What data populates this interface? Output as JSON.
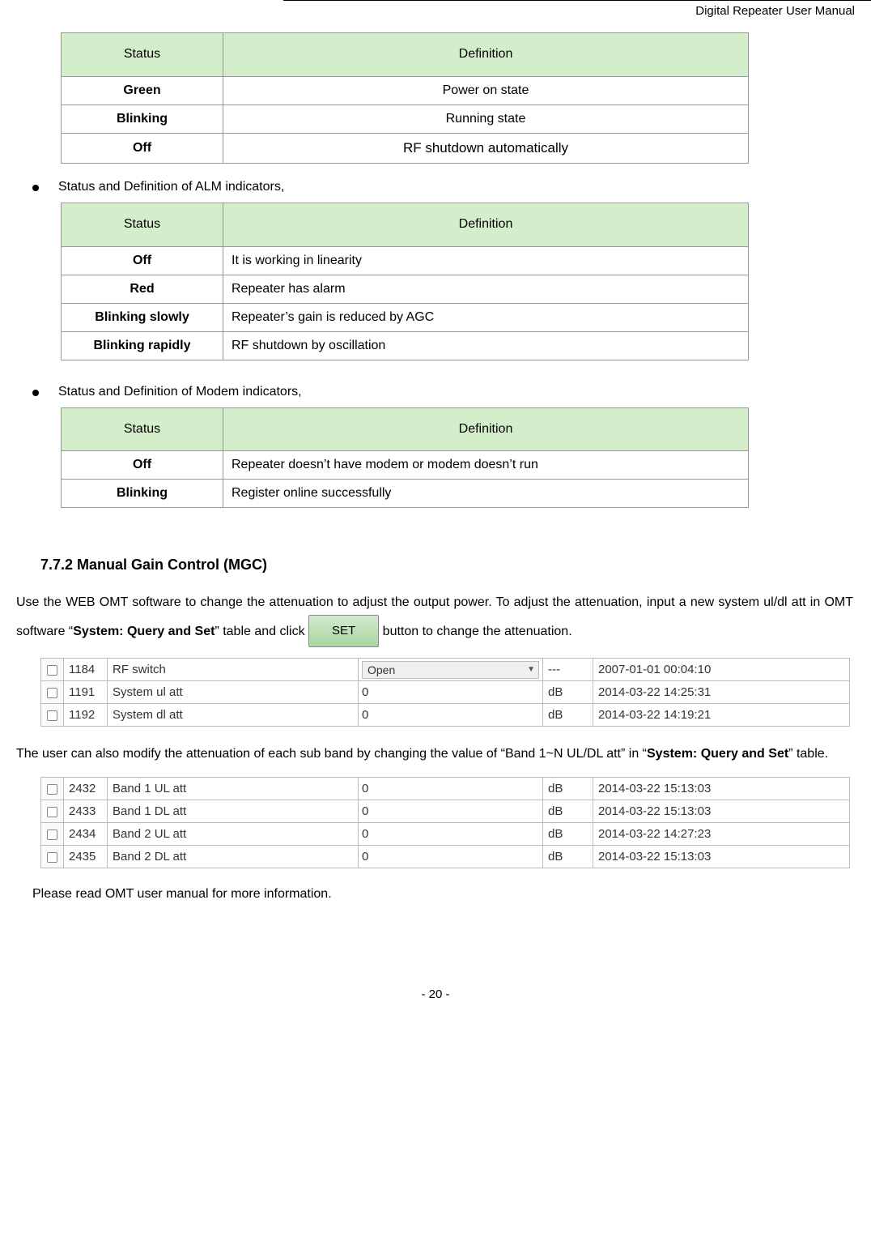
{
  "header": {
    "title": "Digital Repeater User Manual"
  },
  "table1": {
    "cols": [
      "Status",
      "Definition"
    ],
    "rows": [
      {
        "status": "Green",
        "def": "Power on state"
      },
      {
        "status": "Blinking",
        "def": "Running state"
      },
      {
        "status": "Off",
        "def": "RF shutdown automatically"
      }
    ]
  },
  "bullet1": "Status and Definition of ALM indicators,",
  "table2": {
    "cols": [
      "Status",
      "Definition"
    ],
    "rows": [
      {
        "status": "Off",
        "def": "It is working in linearity"
      },
      {
        "status": "Red",
        "def": "Repeater has alarm"
      },
      {
        "status": "Blinking slowly",
        "def": "Repeater’s gain is reduced by AGC"
      },
      {
        "status": "Blinking rapidly",
        "def": "RF shutdown by oscillation"
      }
    ]
  },
  "bullet2": "Status and Definition of Modem indicators,",
  "table3": {
    "cols": [
      "Status",
      "Definition"
    ],
    "rows": [
      {
        "status": "Off",
        "def": "Repeater doesn’t have modem or modem doesn’t run"
      },
      {
        "status": "Blinking",
        "def": "Register online successfully"
      }
    ]
  },
  "section_heading": "7.7.2 Manual Gain Control (MGC)",
  "para1_a": "Use the WEB OMT software to change the attenuation to adjust the output power. To adjust the attenuation, input a new system ul/dl att in OMT software “",
  "para1_bold": "System: Query and Set",
  "para1_b": "” table and click ",
  "set_label": "SET",
  "para1_c": " button to change the attenuation.",
  "omt1": [
    {
      "id": "1184",
      "name": "RF switch",
      "val_type": "select",
      "val": "Open",
      "unit": "---",
      "date": "2007-01-01 00:04:10"
    },
    {
      "id": "1191",
      "name": "System ul att",
      "val_type": "text",
      "val": "0",
      "unit": "dB",
      "date": "2014-03-22 14:25:31"
    },
    {
      "id": "1192",
      "name": "System dl att",
      "val_type": "text",
      "val": "0",
      "unit": "dB",
      "date": "2014-03-22 14:19:21"
    }
  ],
  "para2_a": "The user can also modify the attenuation of each sub band by changing the value of “Band 1~N UL/DL att” in “",
  "para2_bold": "System: Query and Set",
  "para2_b": "” table.",
  "omt2": [
    {
      "id": "2432",
      "name": "Band 1 UL att",
      "val": "0",
      "unit": "dB",
      "date": "2014-03-22 15:13:03"
    },
    {
      "id": "2433",
      "name": "Band 1 DL att",
      "val": "0",
      "unit": "dB",
      "date": "2014-03-22 15:13:03"
    },
    {
      "id": "2434",
      "name": "Band 2 UL att",
      "val": "0",
      "unit": "dB",
      "date": "2014-03-22 14:27:23"
    },
    {
      "id": "2435",
      "name": "Band 2 DL att",
      "val": "0",
      "unit": "dB",
      "date": "2014-03-22 15:13:03"
    }
  ],
  "note": "Please read OMT user manual for more information.",
  "page_no": "- 20 -"
}
